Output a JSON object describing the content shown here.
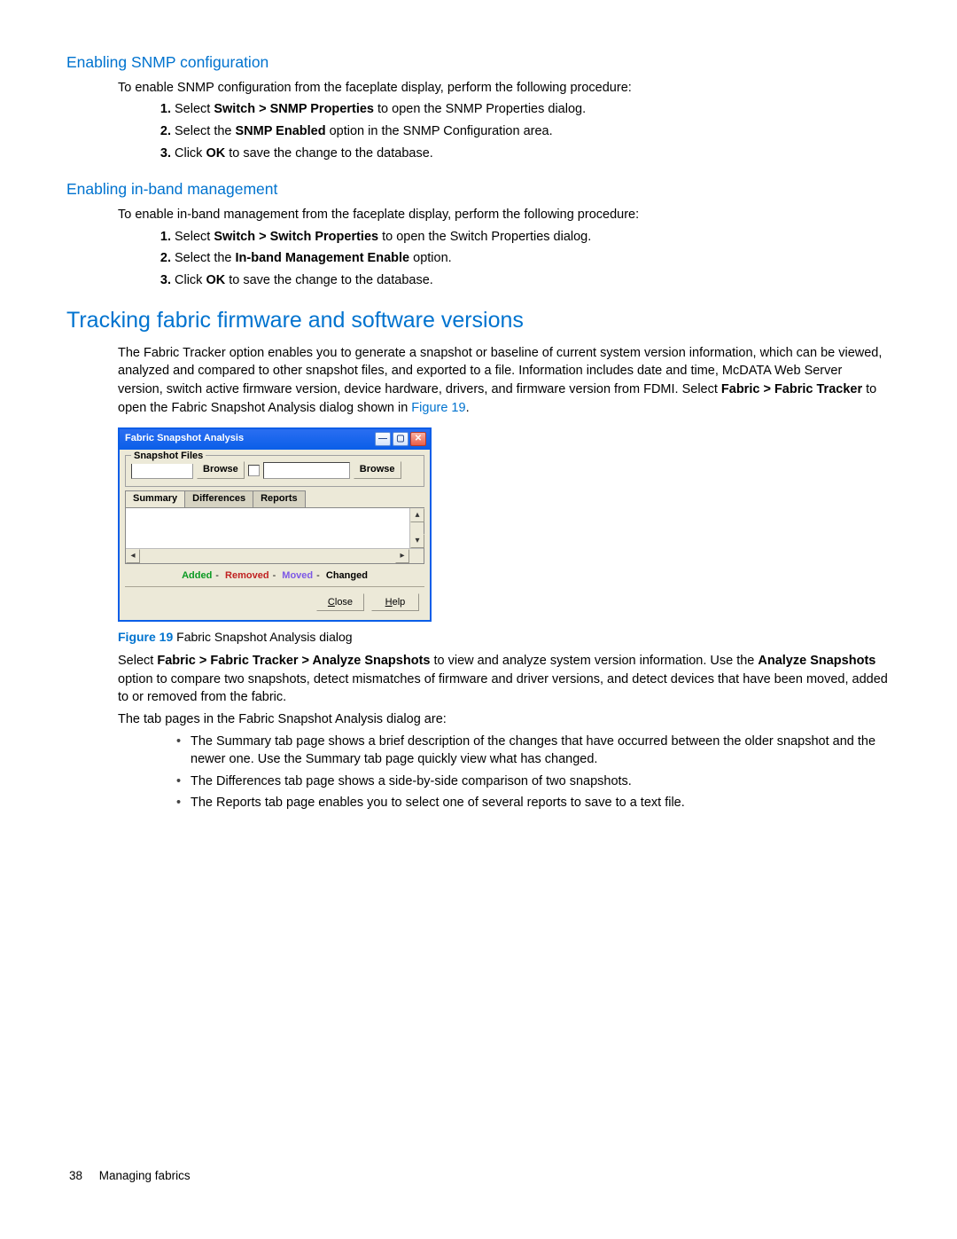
{
  "h3_snmp": "Enabling SNMP configuration",
  "snmp_intro": "To enable SNMP configuration from the faceplate display, perform the following procedure:",
  "snmp_steps": {
    "s1a": "Select ",
    "s1b": "Switch > SNMP Properties",
    "s1c": " to open the SNMP Properties dialog.",
    "s2a": "Select the ",
    "s2b": "SNMP Enabled",
    "s2c": " option in the SNMP Configuration area.",
    "s3a": "Click ",
    "s3b": "OK",
    "s3c": " to save the change to the database."
  },
  "h3_inband": "Enabling in-band management",
  "inband_intro": "To enable in-band management from the faceplate display, perform the following procedure:",
  "inband_steps": {
    "s1a": "Select ",
    "s1b": "Switch > Switch Properties",
    "s1c": " to open the Switch Properties dialog.",
    "s2a": "Select the ",
    "s2b": "In-band Management Enable",
    "s2c": " option.",
    "s3a": "Click ",
    "s3b": "OK",
    "s3c": " to save the change to the database."
  },
  "h2_tracking": "Tracking fabric firmware and software versions",
  "tracking_p_a": "The Fabric Tracker option enables you to generate a snapshot or baseline of current system version information, which can be viewed, analyzed and compared to other snapshot files, and exported to a file. Information includes date and time, McDATA Web Server version, switch active firmware version, device hardware, drivers, and firmware version from FDMI. Select ",
  "tracking_p_bold": "Fabric > Fabric Tracker",
  "tracking_p_b": " to open the Fabric Snapshot Analysis dialog shown in ",
  "tracking_p_link": "Figure 19",
  "tracking_p_end": ".",
  "dialog": {
    "title": "Fabric Snapshot Analysis",
    "fieldset_legend": "Snapshot Files",
    "browse": "Browse",
    "tab_summary": "Summary",
    "tab_differences": "Differences",
    "tab_reports": "Reports",
    "legend_added": "Added",
    "legend_removed": "Removed",
    "legend_moved": "Moved",
    "legend_changed": "Changed",
    "close": "Close",
    "help": "Help",
    "close_mnemonic": "C",
    "help_mnemonic": "H"
  },
  "fig_caption_label": "Figure 19",
  "fig_caption_text": "  Fabric Snapshot Analysis dialog",
  "after_fig_p_a": "Select ",
  "after_fig_p_b1": "Fabric > Fabric Tracker > Analyze Snapshots",
  "after_fig_p_c": " to view and analyze system version information. Use the ",
  "after_fig_p_b2": "Analyze Snapshots",
  "after_fig_p_d": " option to compare two snapshots, detect mismatches of firmware and driver versions, and detect devices that have been moved, added to or removed from the fabric.",
  "tabs_intro": "The tab pages in the Fabric Snapshot Analysis dialog are:",
  "bullets": {
    "b1": "The Summary tab page shows a brief description of the changes that have occurred between the older snapshot and the newer one. Use the Summary tab page quickly view what has changed.",
    "b2": "The Differences tab page shows a side-by-side comparison of two snapshots.",
    "b3": "The Reports tab page enables you to select one of several reports to save to a text file."
  },
  "footer_page": "38",
  "footer_text": "Managing fabrics"
}
